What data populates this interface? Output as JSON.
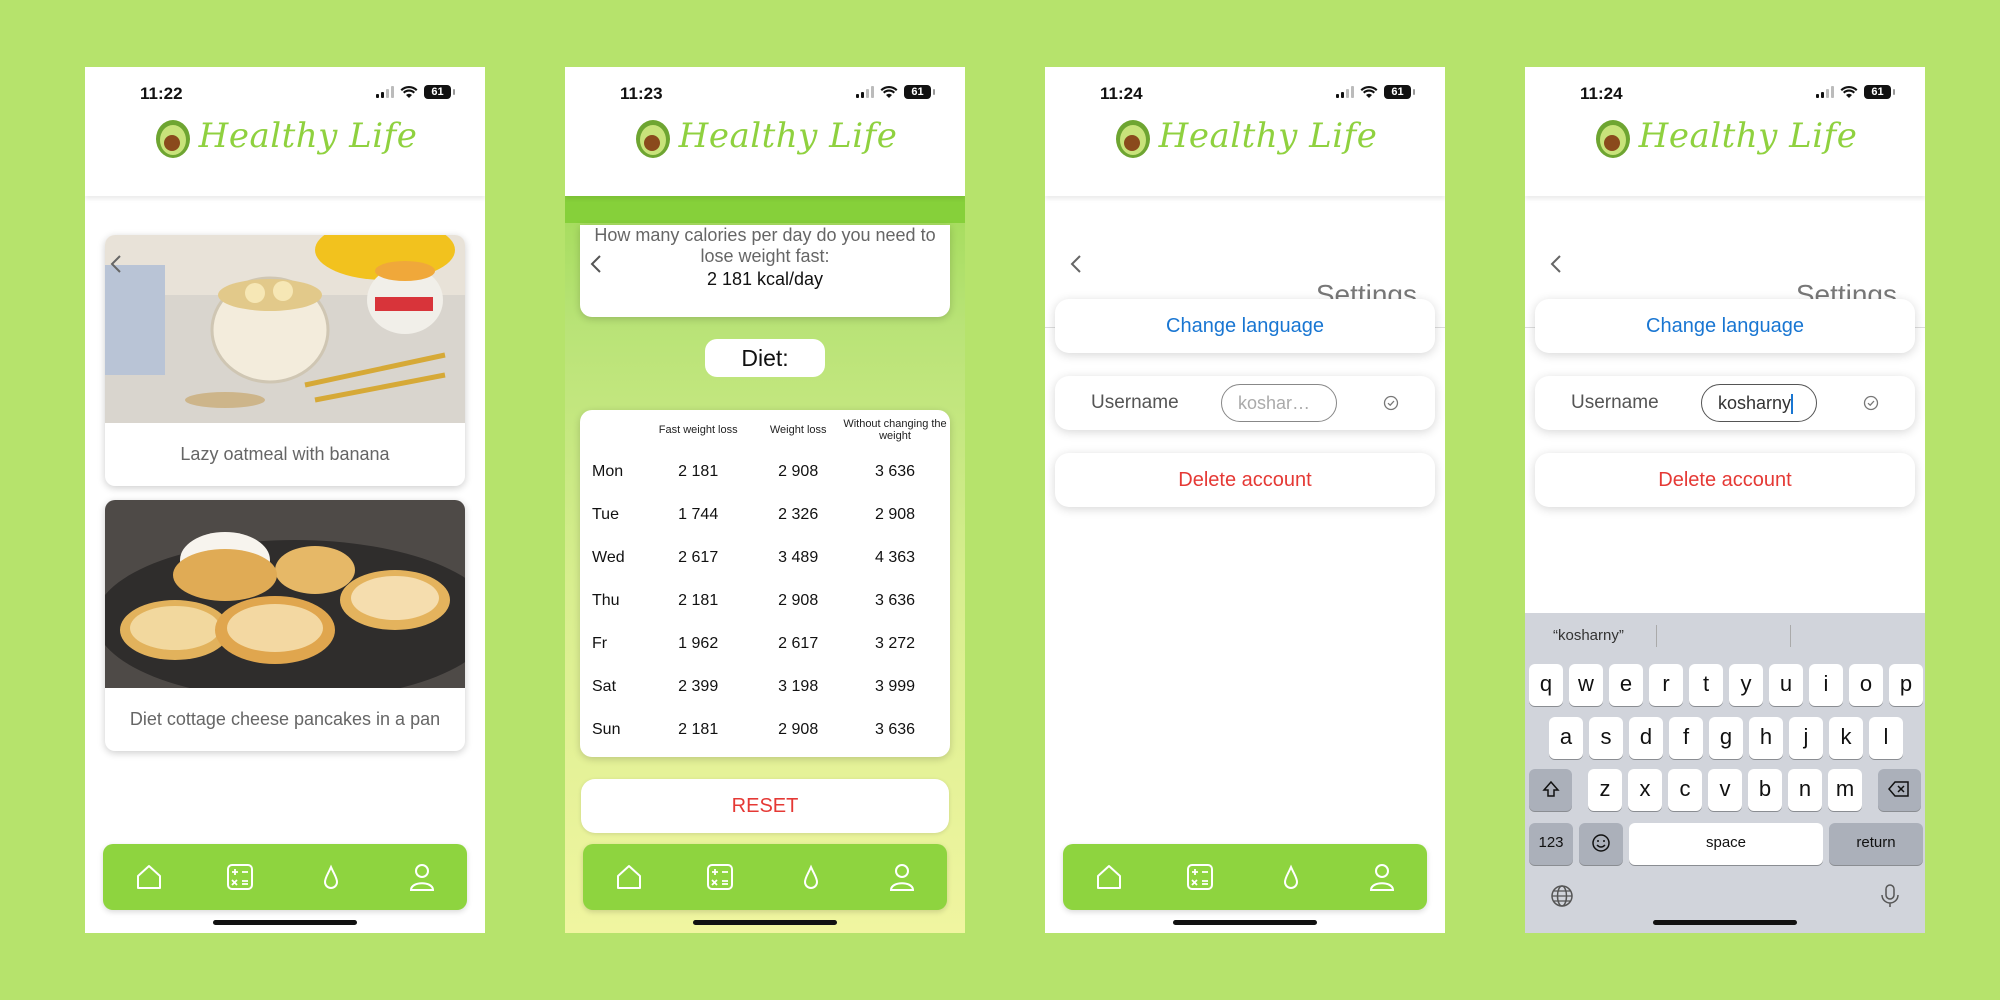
{
  "brand": {
    "title": "Healthy Life"
  },
  "phones": [
    {
      "time": "11:22",
      "battery": "61"
    },
    {
      "time": "11:23",
      "battery": "61"
    },
    {
      "time": "11:24",
      "battery": "61"
    },
    {
      "time": "11:24",
      "battery": "61"
    }
  ],
  "recipes": [
    {
      "caption": "Lazy oatmeal with banana"
    },
    {
      "caption": "Diet cottage cheese pancakes in a pan"
    }
  ],
  "calculator": {
    "question": "How many calories per day do you need to lose weight fast:",
    "result": "2 181  kcal/day",
    "diet_label": "Diet:",
    "columns": [
      "Fast weight loss",
      "Weight loss",
      "Without changing the weight"
    ],
    "rows": [
      {
        "day": "Mon",
        "values": [
          "2 181",
          "2 908",
          "3 636"
        ]
      },
      {
        "day": "Tue",
        "values": [
          "1 744",
          "2 326",
          "2 908"
        ]
      },
      {
        "day": "Wed",
        "values": [
          "2 617",
          "3 489",
          "4 363"
        ]
      },
      {
        "day": "Thu",
        "values": [
          "2 181",
          "2 908",
          "3 636"
        ]
      },
      {
        "day": "Fr",
        "values": [
          "1 962",
          "2 617",
          "3 272"
        ]
      },
      {
        "day": "Sat",
        "values": [
          "2 399",
          "3 198",
          "3 999"
        ]
      },
      {
        "day": "Sun",
        "values": [
          "2 181",
          "2 908",
          "3 636"
        ]
      }
    ],
    "reset_label": "RESET"
  },
  "settings": {
    "title": "Settings",
    "change_language": "Change language",
    "username_label": "Username",
    "username_placeholder": "koshar…",
    "username_value": "kosharny",
    "delete_account": "Delete account"
  },
  "keyboard": {
    "suggestion": "“kosharny”",
    "row1": [
      "q",
      "w",
      "e",
      "r",
      "t",
      "y",
      "u",
      "i",
      "o",
      "p"
    ],
    "row2": [
      "a",
      "s",
      "d",
      "f",
      "g",
      "h",
      "j",
      "k",
      "l"
    ],
    "row3": [
      "z",
      "x",
      "c",
      "v",
      "b",
      "n",
      "m"
    ],
    "numbers_label": "123",
    "space_label": "space",
    "return_label": "return"
  },
  "colors": {
    "background": "#b6e36c",
    "accent": "#8ed43f",
    "link": "#1976d2",
    "danger": "#e53935"
  },
  "tab_icons": [
    "home-icon",
    "calculator-icon",
    "water-drop-icon",
    "profile-icon"
  ]
}
